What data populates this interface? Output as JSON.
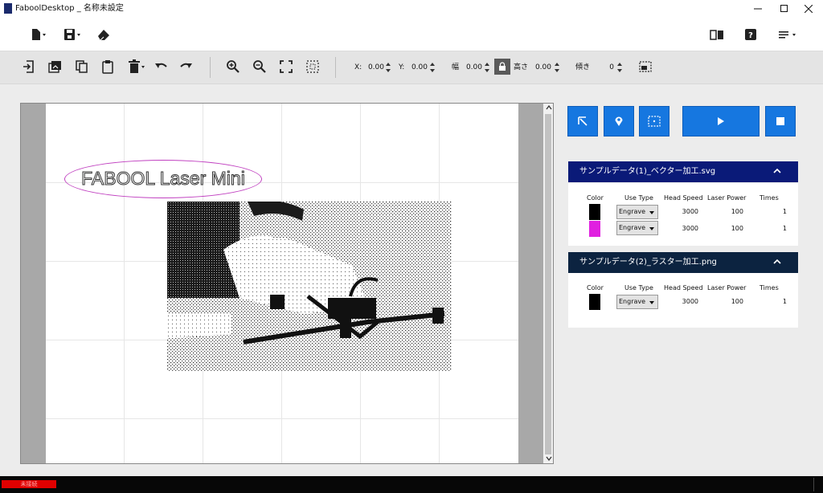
{
  "window": {
    "title": "FaboolDesktop _ 名称未設定",
    "minimize_icon": "minimize-icon",
    "maximize_icon": "maximize-icon",
    "close_icon": "close-icon"
  },
  "toolbar_top": {
    "left": [
      "new-file-icon",
      "save-icon",
      "eraser-icon"
    ],
    "right": [
      "book-icon",
      "help-icon",
      "menu-icon"
    ]
  },
  "toolbar_edit": {
    "icons": [
      "import-icon",
      "image-icon",
      "copy-icon",
      "paste-icon",
      "delete-icon",
      "undo-icon",
      "redo-icon",
      "zoom-in-icon",
      "zoom-out-icon",
      "fit-icon",
      "select-area-icon"
    ],
    "x_label": "X:",
    "x_value": "0.00",
    "y_label": "Y:",
    "y_value": "0.00",
    "width_label": "幅",
    "width_value": "0.00",
    "height_label": "高さ",
    "height_value": "0.00",
    "angle_label": "傾き",
    "angle_value": "0",
    "lock_icon": "lock-icon"
  },
  "canvas": {
    "text_object": "FABOOL Laser Mini",
    "photo_description_icon": "photo-image"
  },
  "actions": {
    "origin_icon": "origin-icon",
    "location_icon": "location-pin-icon",
    "frame_icon": "frame-icon",
    "start_icon": "play-icon",
    "stop_icon": "stop-icon"
  },
  "layers": [
    {
      "name": "サンプルデータ(1)_ベクター加工.svg",
      "header_color": "#0a1a78",
      "columns": [
        "Color",
        "Use Type",
        "Head Speed",
        "Laser Power",
        "Times"
      ],
      "rows": [
        {
          "color": "#000000",
          "use_type": "Engrave",
          "head_speed": "3000",
          "laser_power": "100",
          "times": "1"
        },
        {
          "color": "#e020e0",
          "use_type": "Engrave",
          "head_speed": "3000",
          "laser_power": "100",
          "times": "1"
        }
      ]
    },
    {
      "name": "サンプルデータ(2)_ラスター加工.png",
      "header_color": "#0c2340",
      "columns": [
        "Color",
        "Use Type",
        "Head Speed",
        "Laser Power",
        "Times"
      ],
      "rows": [
        {
          "color": "#000000",
          "use_type": "Engrave",
          "head_speed": "3000",
          "laser_power": "100",
          "times": "1"
        }
      ]
    }
  ],
  "status": {
    "text": "未接続",
    "color": "#e00000"
  }
}
